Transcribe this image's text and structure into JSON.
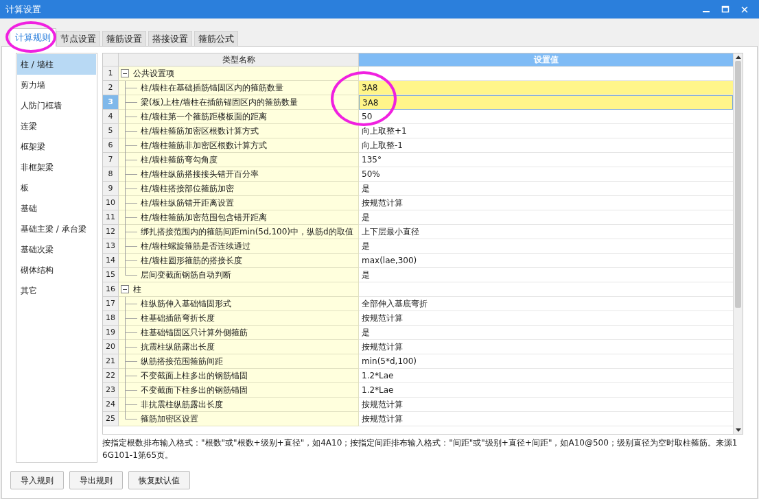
{
  "window": {
    "title": "计算设置"
  },
  "tabs": [
    {
      "label": "计算规则",
      "selected": true
    },
    {
      "label": "节点设置",
      "selected": false
    },
    {
      "label": "箍筋设置",
      "selected": false
    },
    {
      "label": "搭接设置",
      "selected": false
    },
    {
      "label": "箍筋公式",
      "selected": false
    }
  ],
  "sidebar": {
    "items": [
      {
        "label": "柱 / 墙柱",
        "selected": true
      },
      {
        "label": "剪力墙",
        "selected": false
      },
      {
        "label": "人防门框墙",
        "selected": false
      },
      {
        "label": "连梁",
        "selected": false
      },
      {
        "label": "框架梁",
        "selected": false
      },
      {
        "label": "非框架梁",
        "selected": false
      },
      {
        "label": "板",
        "selected": false
      },
      {
        "label": "基础",
        "selected": false
      },
      {
        "label": "基础主梁 / 承台梁",
        "selected": false
      },
      {
        "label": "基础次梁",
        "selected": false
      },
      {
        "label": "砌体结构",
        "selected": false
      },
      {
        "label": "其它",
        "selected": false
      }
    ]
  },
  "table": {
    "columns": [
      "类型名称",
      "设置值"
    ],
    "groups": [
      {
        "number": "1",
        "name": "公共设置项",
        "expanded": true,
        "children": [
          {
            "number": "2",
            "name": "柱/墙柱在基础插筋锚固区内的箍筋数量",
            "value": "3A8",
            "selected": false,
            "highlighted": true
          },
          {
            "number": "3",
            "name": "梁(板)上柱/墙柱在插筋锚固区内的箍筋数量",
            "value": "3A8",
            "selected": true,
            "highlighted": true
          },
          {
            "number": "4",
            "name": "柱/墙柱第一个箍筋距楼板面的距离",
            "value": "50",
            "selected": false,
            "highlighted": false
          },
          {
            "number": "5",
            "name": "柱/墙柱箍筋加密区根数计算方式",
            "value": "向上取整+1",
            "selected": false,
            "highlighted": false
          },
          {
            "number": "6",
            "name": "柱/墙柱箍筋非加密区根数计算方式",
            "value": "向上取整-1",
            "selected": false,
            "highlighted": false
          },
          {
            "number": "7",
            "name": "柱/墙柱箍筋弯勾角度",
            "value": "135°",
            "selected": false,
            "highlighted": false
          },
          {
            "number": "8",
            "name": "柱/墙柱纵筋搭接接头错开百分率",
            "value": "50%",
            "selected": false,
            "highlighted": false
          },
          {
            "number": "9",
            "name": "柱/墙柱搭接部位箍筋加密",
            "value": "是",
            "selected": false,
            "highlighted": false
          },
          {
            "number": "10",
            "name": "柱/墙柱纵筋错开距离设置",
            "value": "按规范计算",
            "selected": false,
            "highlighted": false
          },
          {
            "number": "11",
            "name": "柱/墙柱箍筋加密范围包含错开距离",
            "value": "是",
            "selected": false,
            "highlighted": false
          },
          {
            "number": "12",
            "name": "绑扎搭接范围内的箍筋间距min(5d,100)中，纵筋d的取值",
            "value": "上下层最小直径",
            "selected": false,
            "highlighted": false
          },
          {
            "number": "13",
            "name": "柱/墙柱螺旋箍筋是否连续通过",
            "value": "是",
            "selected": false,
            "highlighted": false
          },
          {
            "number": "14",
            "name": "柱/墙柱圆形箍筋的搭接长度",
            "value": "max(lae,300)",
            "selected": false,
            "highlighted": false
          },
          {
            "number": "15",
            "name": "层间变截面钢筋自动判断",
            "value": "是",
            "selected": false,
            "highlighted": false
          }
        ]
      },
      {
        "number": "16",
        "name": "柱",
        "expanded": true,
        "children": [
          {
            "number": "17",
            "name": "柱纵筋伸入基础锚固形式",
            "value": "全部伸入基底弯折",
            "selected": false,
            "highlighted": false
          },
          {
            "number": "18",
            "name": "柱基础插筋弯折长度",
            "value": "按规范计算",
            "selected": false,
            "highlighted": false
          },
          {
            "number": "19",
            "name": "柱基础锚固区只计算外侧箍筋",
            "value": "是",
            "selected": false,
            "highlighted": false
          },
          {
            "number": "20",
            "name": "抗震柱纵筋露出长度",
            "value": "按规范计算",
            "selected": false,
            "highlighted": false
          },
          {
            "number": "21",
            "name": "纵筋搭接范围箍筋间距",
            "value": "min(5*d,100)",
            "selected": false,
            "highlighted": false
          },
          {
            "number": "22",
            "name": "不变截面上柱多出的钢筋锚固",
            "value": "1.2*Lae",
            "selected": false,
            "highlighted": false
          },
          {
            "number": "23",
            "name": "不变截面下柱多出的钢筋锚固",
            "value": "1.2*Lae",
            "selected": false,
            "highlighted": false
          },
          {
            "number": "24",
            "name": "非抗震柱纵筋露出长度",
            "value": "按规范计算",
            "selected": false,
            "highlighted": false
          },
          {
            "number": "25",
            "name": "箍筋加密区设置",
            "value": "按规范计算",
            "selected": false,
            "highlighted": false
          }
        ]
      }
    ]
  },
  "description": "按指定根数排布输入格式：\"根数\"或\"根数+级别+直径\"，如4A10；按指定间距排布输入格式：\"间距\"或\"级别+直径+间距\"，如A10@500；级别直径为空时取柱箍筋。来源16G101-1第65页。",
  "buttons": [
    "导入规则",
    "导出规则",
    "恢复默认值"
  ]
}
